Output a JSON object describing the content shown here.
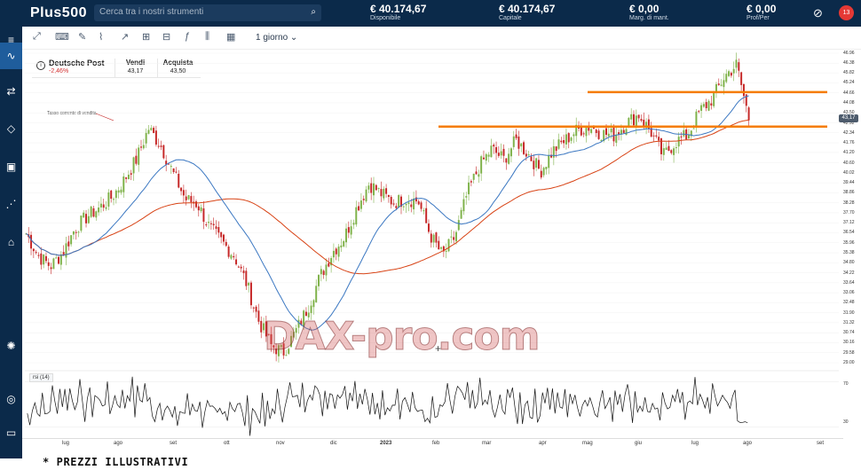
{
  "topbar": {
    "logo": "Plus500",
    "search_placeholder": "Cerca tra i nostri strumenti",
    "stats": [
      {
        "value": "€ 40.174,67",
        "label": "Disponibile"
      },
      {
        "value": "€ 40.174,67",
        "label": "Capitale"
      },
      {
        "value": "€ 0,00",
        "label": "Marg. di mant."
      },
      {
        "value": "€ 0,00",
        "label": "Prof/Per"
      }
    ],
    "notifications": "13"
  },
  "toolbar": {
    "timeframe": "1 giorno"
  },
  "quote": {
    "name": "Deutsche Post",
    "change": "-2,46%",
    "sell_label": "Vendi",
    "sell_price": "43,17",
    "buy_label": "Acquista",
    "buy_price": "43,50"
  },
  "annotation": "Tasso corrente di vendita",
  "rsi_label": "rsi (14)",
  "watermark": "DAX-pro.com",
  "footnote": "* PREZZI ILLUSTRATIVI",
  "colors": {
    "up_candle": "#7fb24a",
    "down_candle": "#c62828",
    "ma_slow": "#d84315",
    "ma_fast": "#3c78c2",
    "level_lines": "#f57c00",
    "topbar": "#0b2a4a"
  },
  "chart_data": [
    {
      "type": "candlestick",
      "title": "Deutsche Post",
      "x_ticks": [
        "lug",
        "ago",
        "set",
        "ott",
        "nov",
        "dic",
        "2023",
        "feb",
        "mar",
        "apr",
        "mag",
        "giu",
        "lug",
        "ago",
        "set"
      ],
      "y_ticks": [
        46.96,
        46.38,
        45.82,
        45.24,
        44.66,
        44.08,
        43.5,
        42.92,
        42.34,
        41.76,
        41.2,
        40.6,
        40.02,
        39.44,
        38.86,
        38.28,
        37.7,
        37.12,
        36.54,
        35.96,
        35.38,
        34.8,
        34.22,
        33.64,
        33.06,
        32.48,
        31.9,
        31.32,
        30.74,
        30.16,
        29.58,
        29.0
      ],
      "ylim": [
        29.0,
        46.96
      ],
      "last_price": "43,17",
      "horizontal_levels": [
        44.7,
        42.7
      ],
      "series": [
        {
          "name": "close",
          "values": [
            36.5,
            35.2,
            34.6,
            35.4,
            36.8,
            37.5,
            38.0,
            38.6,
            39.6,
            40.8,
            42.6,
            41.6,
            40.0,
            38.5,
            38.2,
            36.8,
            36.0,
            35.2,
            33.6,
            31.4,
            30.0,
            29.6,
            30.8,
            32.2,
            34.0,
            35.4,
            36.3,
            38.0,
            39.4,
            38.8,
            38.3,
            38.5,
            38.4,
            36.4,
            35.2,
            36.3,
            38.8,
            40.4,
            41.4,
            40.8,
            41.9,
            41.1,
            40.1,
            41.3,
            41.9,
            42.5,
            42.7,
            42.3,
            42.2,
            42.9,
            43.4,
            42.4,
            41.0,
            41.8,
            42.2,
            43.6,
            44.3,
            45.6,
            46.3,
            43.17
          ]
        }
      ]
    },
    {
      "type": "line",
      "title": "rsi (14)",
      "y_ticks": [
        70,
        30
      ],
      "ylim": [
        20,
        80
      ]
    }
  ]
}
